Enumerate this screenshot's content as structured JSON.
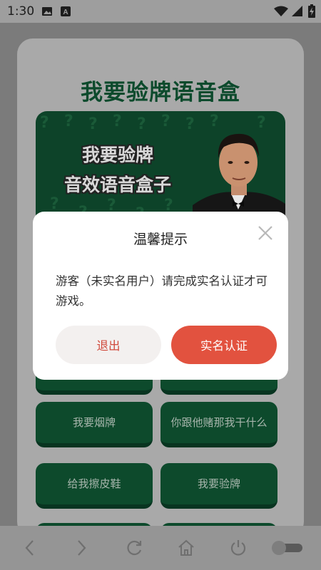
{
  "status_bar": {
    "time": "1:30",
    "left_icons": [
      "image-icon",
      "font-a-icon"
    ],
    "right_icons": [
      "wifi-icon",
      "signal-icon",
      "battery-icon"
    ]
  },
  "app": {
    "title": "我要验牌语音盒",
    "banner": {
      "line1": "我要验牌",
      "line2": "音效语音盒子"
    },
    "sound_buttons": [
      {
        "label": ""
      },
      {
        "label": ""
      },
      {
        "label": "我要烟牌"
      },
      {
        "label": "你跟他赌那我干什么"
      },
      {
        "label": "给我擦皮鞋"
      },
      {
        "label": "我要验牌"
      }
    ]
  },
  "dialog": {
    "title": "温馨提示",
    "message": "游客（未实名用户）请完成实名认证才可游戏。",
    "exit_label": "退出",
    "verify_label": "实名认证"
  },
  "nav_bar": {
    "icons": [
      "back-icon",
      "forward-icon",
      "refresh-icon",
      "home-icon",
      "power-icon",
      "toggle-switch"
    ]
  },
  "colors": {
    "brand_green": "#0d4a2c",
    "accent_red": "#e2523f",
    "exit_text": "#d04a3c"
  }
}
